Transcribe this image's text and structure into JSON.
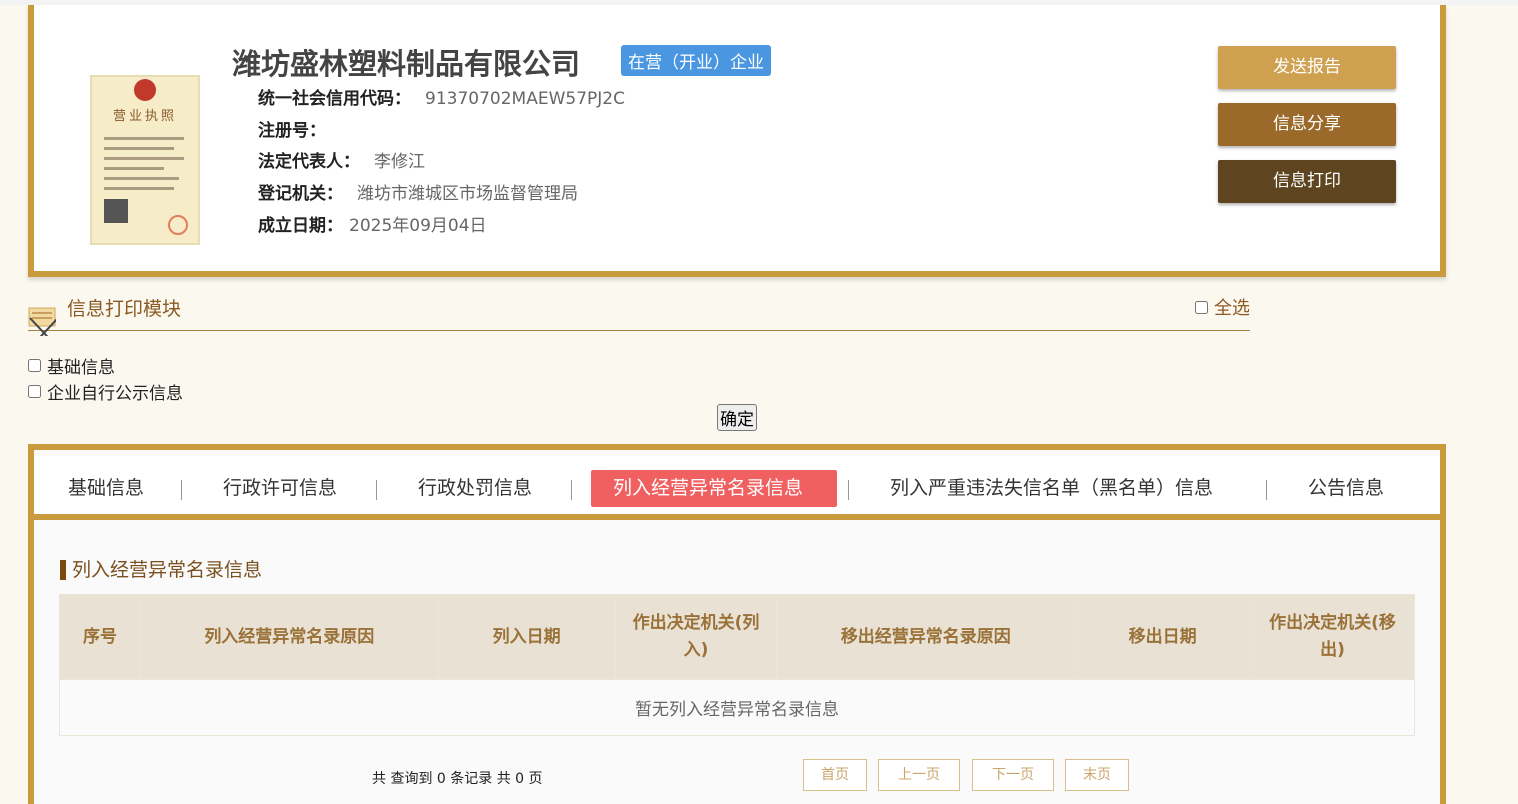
{
  "company": {
    "name": "潍坊盛林塑料制品有限公司",
    "status": "在营（开业）企业",
    "license_title": "营业执照",
    "fields": [
      {
        "label": "统一社会信用代码：",
        "value": "91370702MAEW57PJ2C"
      },
      {
        "label": "注册号：",
        "value": ""
      },
      {
        "label": "法定代表人：",
        "value": "李修江"
      },
      {
        "label": "登记机关：",
        "value": "潍坊市潍城区市场监督管理局"
      },
      {
        "label": "成立日期：",
        "value": "2025年09月04日"
      }
    ]
  },
  "actions": {
    "send": "发送报告",
    "share": "信息分享",
    "print": "信息打印"
  },
  "print_module": {
    "title": "信息打印模块",
    "select_all": "全选",
    "options": [
      "基础信息",
      "企业自行公示信息"
    ],
    "confirm": "确定"
  },
  "tabs": [
    "基础信息",
    "行政许可信息",
    "行政处罚信息",
    "列入经营异常名录信息",
    "列入严重违法失信名单（黑名单）信息",
    "公告信息"
  ],
  "section": {
    "title": "列入经营异常名录信息",
    "columns": [
      "序号",
      "列入经营异常名录原因",
      "列入日期",
      "作出决定机关(列入)",
      "移出经营异常名录原因",
      "移出日期",
      "作出决定机关(移出)"
    ],
    "empty": "暂无列入经营异常名录信息"
  },
  "pagination": {
    "summary": "共 查询到 0 条记录 共 0 页",
    "first": "首页",
    "prev": "上一页",
    "next": "下一页",
    "last": "末页"
  }
}
